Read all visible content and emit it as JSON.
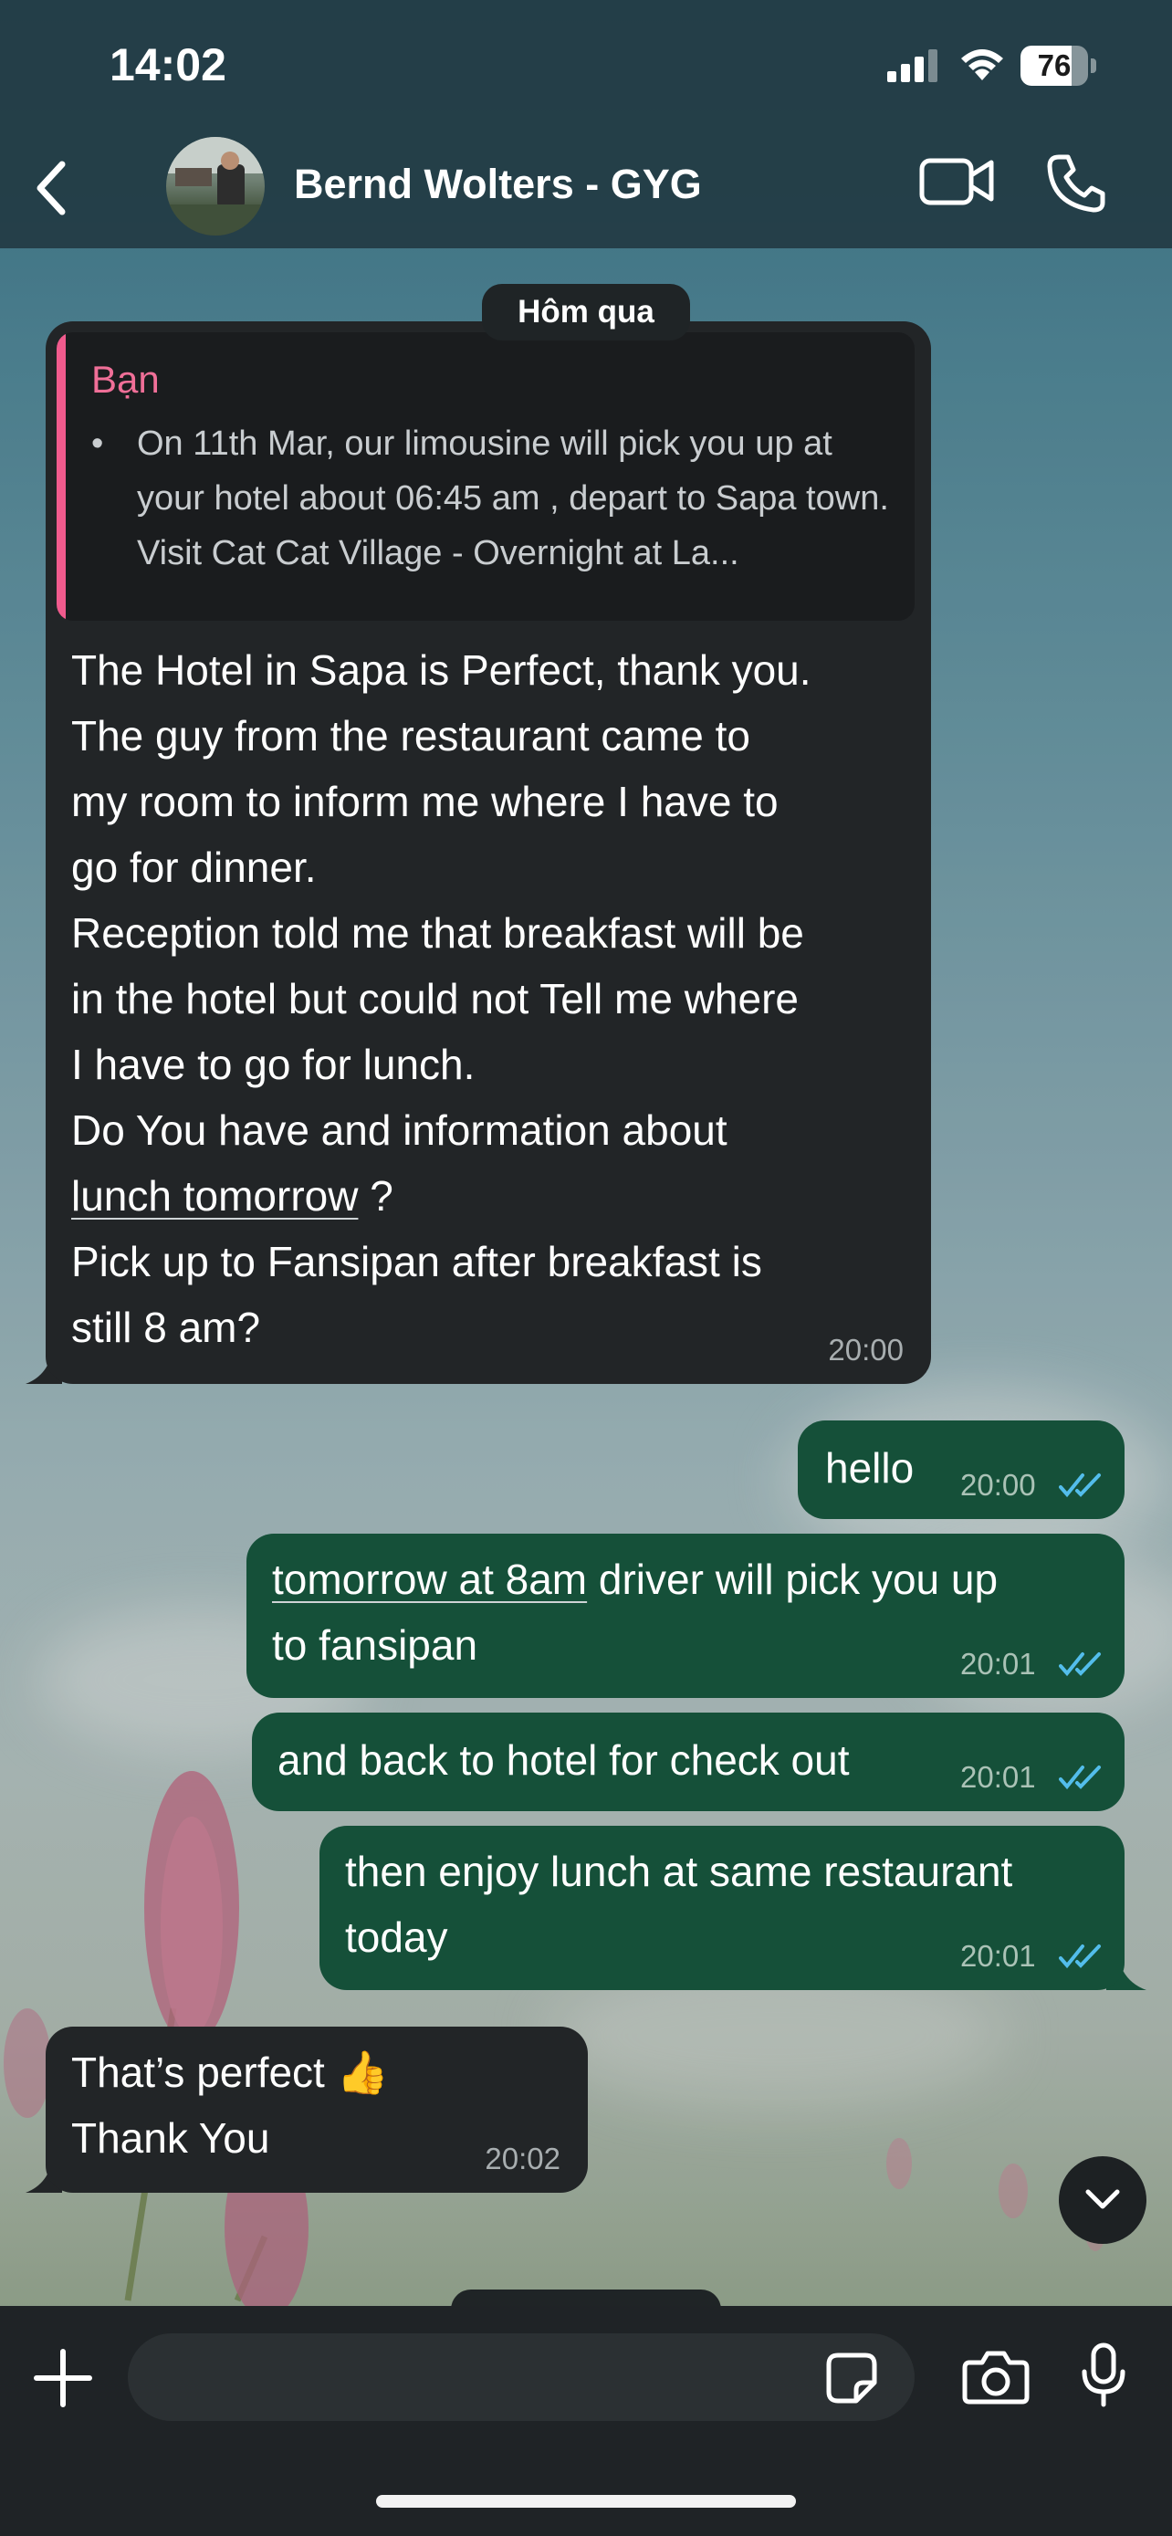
{
  "status_bar": {
    "time": "14:02",
    "battery_level": "76",
    "battery_fraction": 0.76
  },
  "header": {
    "contact_name": "Bernd Wolters - GYG",
    "icons": {
      "back": "chevron-left-icon",
      "video": "video-camera-icon",
      "call": "phone-icon"
    }
  },
  "chat": {
    "date_separator": "Hôm qua",
    "messages": [
      {
        "direction": "incoming",
        "quote": {
          "sender": "Bạn",
          "sender_color": "#f06f98",
          "bullet": "•",
          "text": "On 11th Mar, our limousine will pick you up at your hotel about 06:45 am , depart to Sapa town. Visit Cat Cat Village - Overnight at La..."
        },
        "text_pre": "The Hotel in Sapa is Perfect, thank you.\nThe guy from the restaurant came to\nmy room to inform me where I have to\ngo for dinner.\nReception told me that breakfast will be\nin the hotel but could not Tell me where\nI have to go for lunch.\nDo You have and information about\n",
        "text_link": "lunch tomorrow",
        "text_post": " ?\nPick up to Fansipan after breakfast is\nstill 8 am?",
        "time": "20:00"
      },
      {
        "direction": "outgoing",
        "text": "hello",
        "time": "20:00",
        "status": "read"
      },
      {
        "direction": "outgoing",
        "text_link": "tomorrow at 8am",
        "text_post": " driver will pick you up\nto fansipan",
        "time": "20:01",
        "status": "read"
      },
      {
        "direction": "outgoing",
        "text": "and back to hotel for check out",
        "time": "20:01",
        "status": "read"
      },
      {
        "direction": "outgoing",
        "text": "then enjoy lunch at same restaurant\ntoday",
        "time": "20:01",
        "status": "read"
      },
      {
        "direction": "incoming",
        "text": "That’s perfect 👍\nThank You",
        "time": "20:02"
      }
    ]
  },
  "composer": {
    "placeholder": "",
    "icons": {
      "plus": "plus-icon",
      "sticker": "sticker-icon",
      "camera": "camera-icon",
      "mic": "microphone-icon"
    }
  },
  "colors": {
    "outgoing_bubble": "#155039",
    "incoming_bubble": "#222527",
    "read_ticks": "#53bdeb",
    "quote_bar": "#f05b8d"
  }
}
